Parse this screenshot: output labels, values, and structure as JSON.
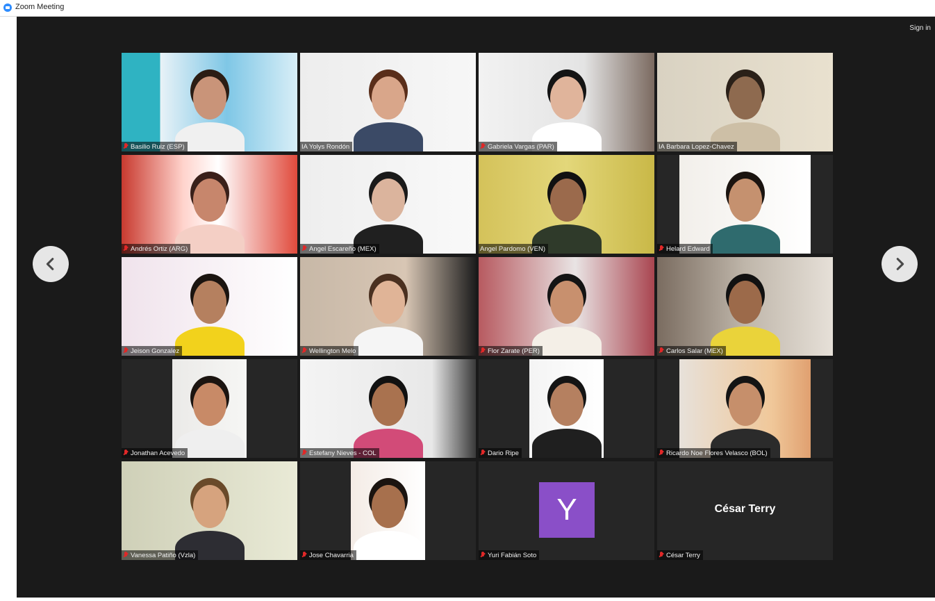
{
  "window": {
    "title": "Zoom Meeting"
  },
  "header": {
    "sign_in_label": "Sign in"
  },
  "navigation": {
    "prev_icon": "chevron-left-icon",
    "next_icon": "chevron-right-icon"
  },
  "colors": {
    "stage_bg": "#1a1a1a",
    "active_speaker_border": "#b6e21c",
    "muted_mic": "#e02828",
    "avatar_bg": "#8a4fc8"
  },
  "participants": [
    {
      "name": "Basilio Ruiz (ESP)",
      "muted": true
    },
    {
      "name": "IA Yolys Rondón",
      "muted": false,
      "active": true
    },
    {
      "name": "Gabriela Vargas (PAR)",
      "muted": true
    },
    {
      "name": "IA Barbara Lopez-Chavez",
      "muted": false
    },
    {
      "name": "Andrés Ortiz (ARG)",
      "muted": true
    },
    {
      "name": "Angel Escareño (MEX)",
      "muted": true
    },
    {
      "name": "Angel Pardomo (VEN)",
      "muted": false
    },
    {
      "name": "Helard Edward",
      "muted": true
    },
    {
      "name": "Jeison Gonzalez",
      "muted": true
    },
    {
      "name": "Wellington Melo",
      "muted": true
    },
    {
      "name": "Flor Zarate (PER)",
      "muted": true
    },
    {
      "name": "Carlos Salar (MEX)",
      "muted": true
    },
    {
      "name": "Jonathan Acevedo",
      "muted": true
    },
    {
      "name": "Estefany Nieves - COL",
      "muted": true
    },
    {
      "name": "Dario Ripe",
      "muted": true
    },
    {
      "name": "Ricardo Noe Flores Velasco (BOL)",
      "muted": true
    },
    {
      "name": "Vanessa Patiño (Vzla)",
      "muted": true
    },
    {
      "name": "Jose Chavarria",
      "muted": true
    },
    {
      "name": "Yuri Fabián Soto",
      "muted": true,
      "video_off": true,
      "avatar_letter": "Y"
    },
    {
      "name": "César Terry",
      "muted": true,
      "video_off": true,
      "display_name": "César Terry"
    }
  ]
}
